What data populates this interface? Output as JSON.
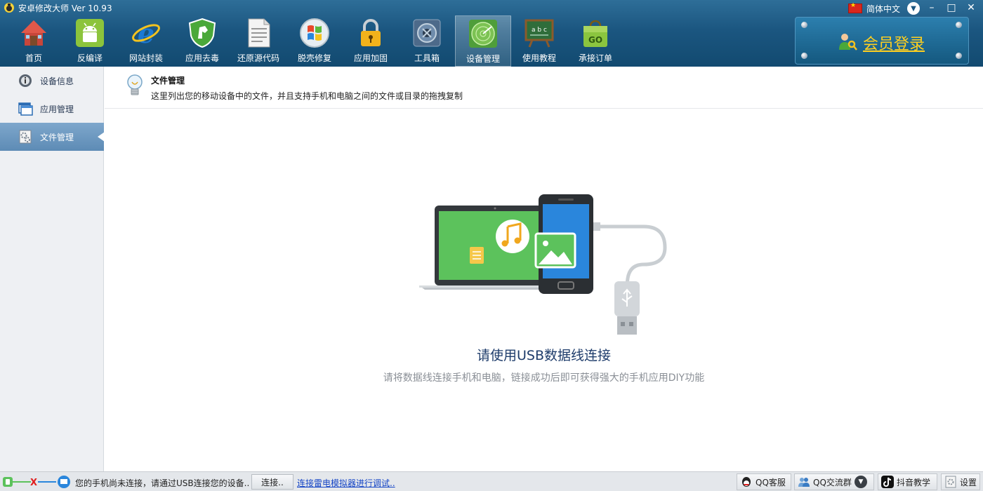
{
  "app": {
    "title": "安卓修改大师 Ver 10.93"
  },
  "language": {
    "label": "简体中文"
  },
  "window_controls": {
    "minimize": "–",
    "maximize": "□",
    "close": "✕"
  },
  "toolbar": {
    "items": [
      {
        "label": "首页",
        "icon": "home-icon"
      },
      {
        "label": "反编译",
        "icon": "android-icon"
      },
      {
        "label": "网站封装",
        "icon": "ie-icon"
      },
      {
        "label": "应用去毒",
        "icon": "shield-icon"
      },
      {
        "label": "还原源代码",
        "icon": "document-icon"
      },
      {
        "label": "脱壳修复",
        "icon": "windows-ball-icon"
      },
      {
        "label": "应用加固",
        "icon": "lock-icon"
      },
      {
        "label": "工具箱",
        "icon": "toolbox-icon"
      },
      {
        "label": "设备管理",
        "icon": "radar-icon",
        "active": true
      },
      {
        "label": "使用教程",
        "icon": "chalkboard-icon"
      },
      {
        "label": "承接订单",
        "icon": "go-bag-icon"
      }
    ]
  },
  "member": {
    "label": "会员登录",
    "color": "#ffcf1f"
  },
  "sidebar": {
    "items": [
      {
        "label": "设备信息",
        "icon": "info-icon"
      },
      {
        "label": "应用管理",
        "icon": "window-icon"
      },
      {
        "label": "文件管理",
        "icon": "gear-file-icon",
        "active": true
      }
    ]
  },
  "main": {
    "header_title": "文件管理",
    "header_desc": "这里列出您的移动设备中的文件，并且支持手机和电脑之间的文件或目录的拖拽复制",
    "usb_title": "请使用USB数据线连接",
    "usb_desc": "请将数据线连接手机和电脑，链接成功后即可获得强大的手机应用DIY功能"
  },
  "statusbar": {
    "status_text": "您的手机尚未连接，请通过USB连接您的设备..",
    "connect_button": "连接..",
    "emulator_link": "连接雷电模拟器进行调试..",
    "buttons": [
      {
        "label": "QQ客服",
        "icon": "qq-icon"
      },
      {
        "label": "QQ交流群",
        "icon": "qq-group-icon"
      },
      {
        "label": "抖音教学",
        "icon": "douyin-icon"
      },
      {
        "label": "设置",
        "icon": "settings-icon"
      }
    ]
  },
  "colors": {
    "toolbar_bg": "#1b5680",
    "accent_green": "#5cc25c",
    "accent_blue": "#2a86dc",
    "link": "#1545c6"
  }
}
